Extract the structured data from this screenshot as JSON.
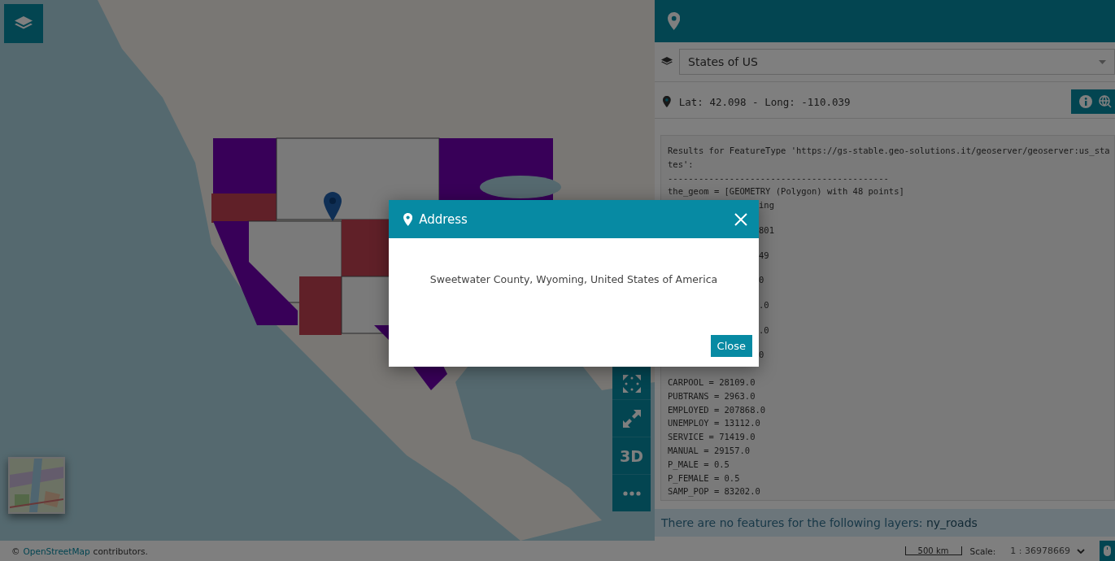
{
  "map": {
    "toolbar": {
      "mode_button": "3D"
    }
  },
  "panel": {
    "layer_select": {
      "value": "States of US"
    },
    "coordinates": "Lat: 42.098 - Long: -110.039",
    "results": {
      "lines_before": [
        "Results for FeatureType 'https://gs-stable.geo-solutions.it/geoserver/geoserver:us_states':",
        "-------------------------------------------",
        "the_geom = [GEOMETRY (Polygon) with 48 points]"
      ],
      "fragments": [
        "ing",
        "801",
        "49",
        "0",
        ".0",
        ".0",
        "0"
      ],
      "lines_after": [
        "CARPOOL = 28109.0",
        "PUBTRANS = 2963.0",
        "EMPLOYED = 207868.0",
        "UNEMPLOY = 13112.0",
        "SERVICE = 71419.0",
        "MANUAL = 29157.0",
        "P_MALE = 0.5",
        "P_FEMALE = 0.5",
        "SAMP_POP = 83202.0"
      ]
    },
    "notice": "There are no features for the following layers: **ny_roads**"
  },
  "modal": {
    "title": "Address",
    "address": "Sweetwater County, Wyoming, United States of America",
    "button": "Close"
  },
  "footer": {
    "attribution_prefix": "©",
    "attribution_link": "OpenStreetMap",
    "attribution_suffix": "contributors.",
    "scale_bar": "500 km",
    "scale_label": "Scale:",
    "scale_value": "1 : 36978669"
  }
}
